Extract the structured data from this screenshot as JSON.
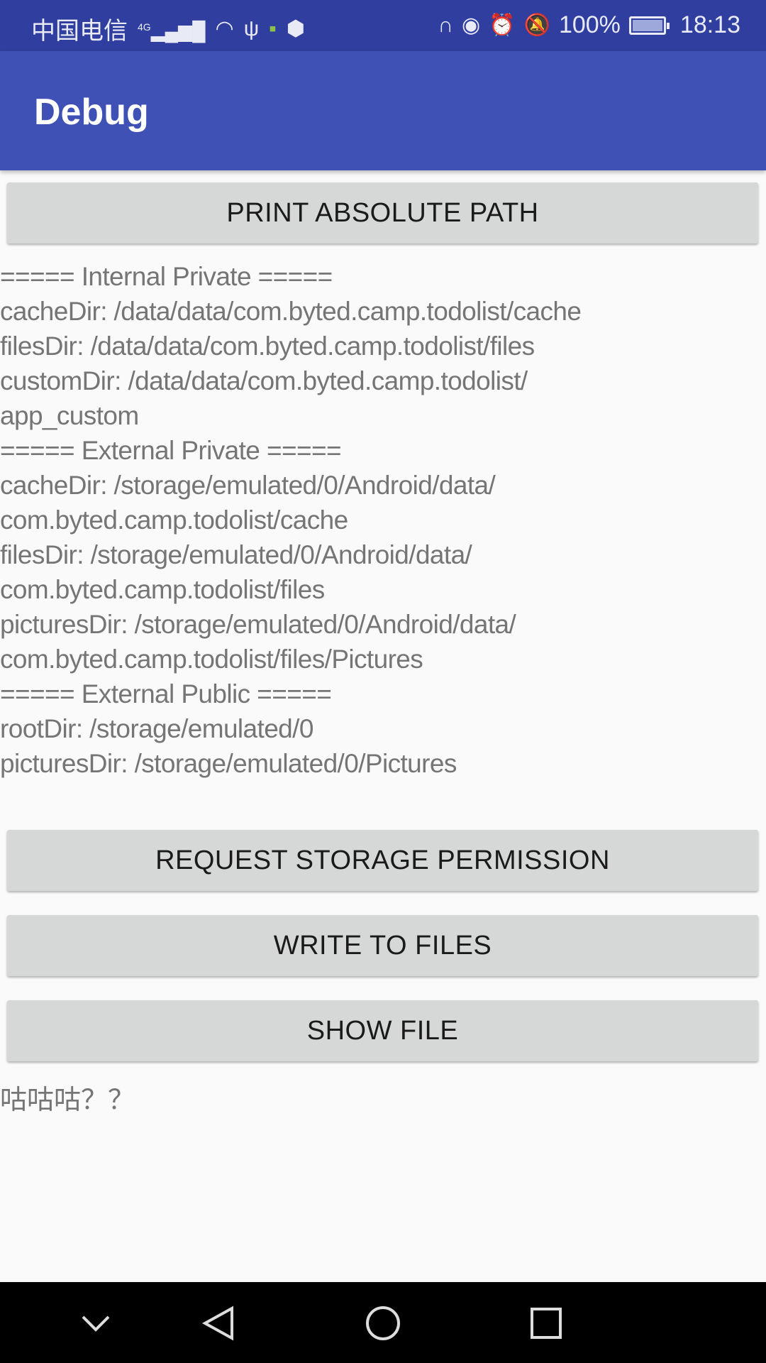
{
  "status_bar": {
    "carrier": "中国电信",
    "network": "4G",
    "battery_percent": "100%",
    "battery_level": 1.0,
    "time": "18:13",
    "icons_left": [
      "signal-icon",
      "wifi-icon",
      "usb-icon",
      "notification-app-icon",
      "stop-hand-icon"
    ],
    "icons_right": [
      "headset-icon",
      "eye-icon",
      "alarm-icon",
      "bell-off-icon",
      "battery-charging-icon"
    ]
  },
  "app_bar": {
    "title": "Debug",
    "color": "#3f51b5"
  },
  "buttons": {
    "print_path": "PRINT ABSOLUTE PATH",
    "request_permission": "REQUEST STORAGE PERMISSION",
    "write_files": "WRITE TO FILES",
    "show_file": "SHOW FILE"
  },
  "paths_output": [
    "===== Internal Private =====",
    "cacheDir: /data/data/com.byted.camp.todolist/cache",
    "filesDir: /data/data/com.byted.camp.todolist/files",
    "customDir: /data/data/com.byted.camp.todolist/",
    "app_custom",
    "===== External Private =====",
    "cacheDir: /storage/emulated/0/Android/data/",
    "com.byted.camp.todolist/cache",
    "filesDir: /storage/emulated/0/Android/data/",
    "com.byted.camp.todolist/files",
    "picturesDir: /storage/emulated/0/Android/data/",
    "com.byted.camp.todolist/files/Pictures",
    "===== External Public =====",
    "rootDir: /storage/emulated/0",
    "picturesDir: /storage/emulated/0/Pictures"
  ],
  "file_content": "咕咕咕？？",
  "nav_bar": [
    "collapse-icon",
    "back-icon",
    "home-icon",
    "recents-icon"
  ]
}
